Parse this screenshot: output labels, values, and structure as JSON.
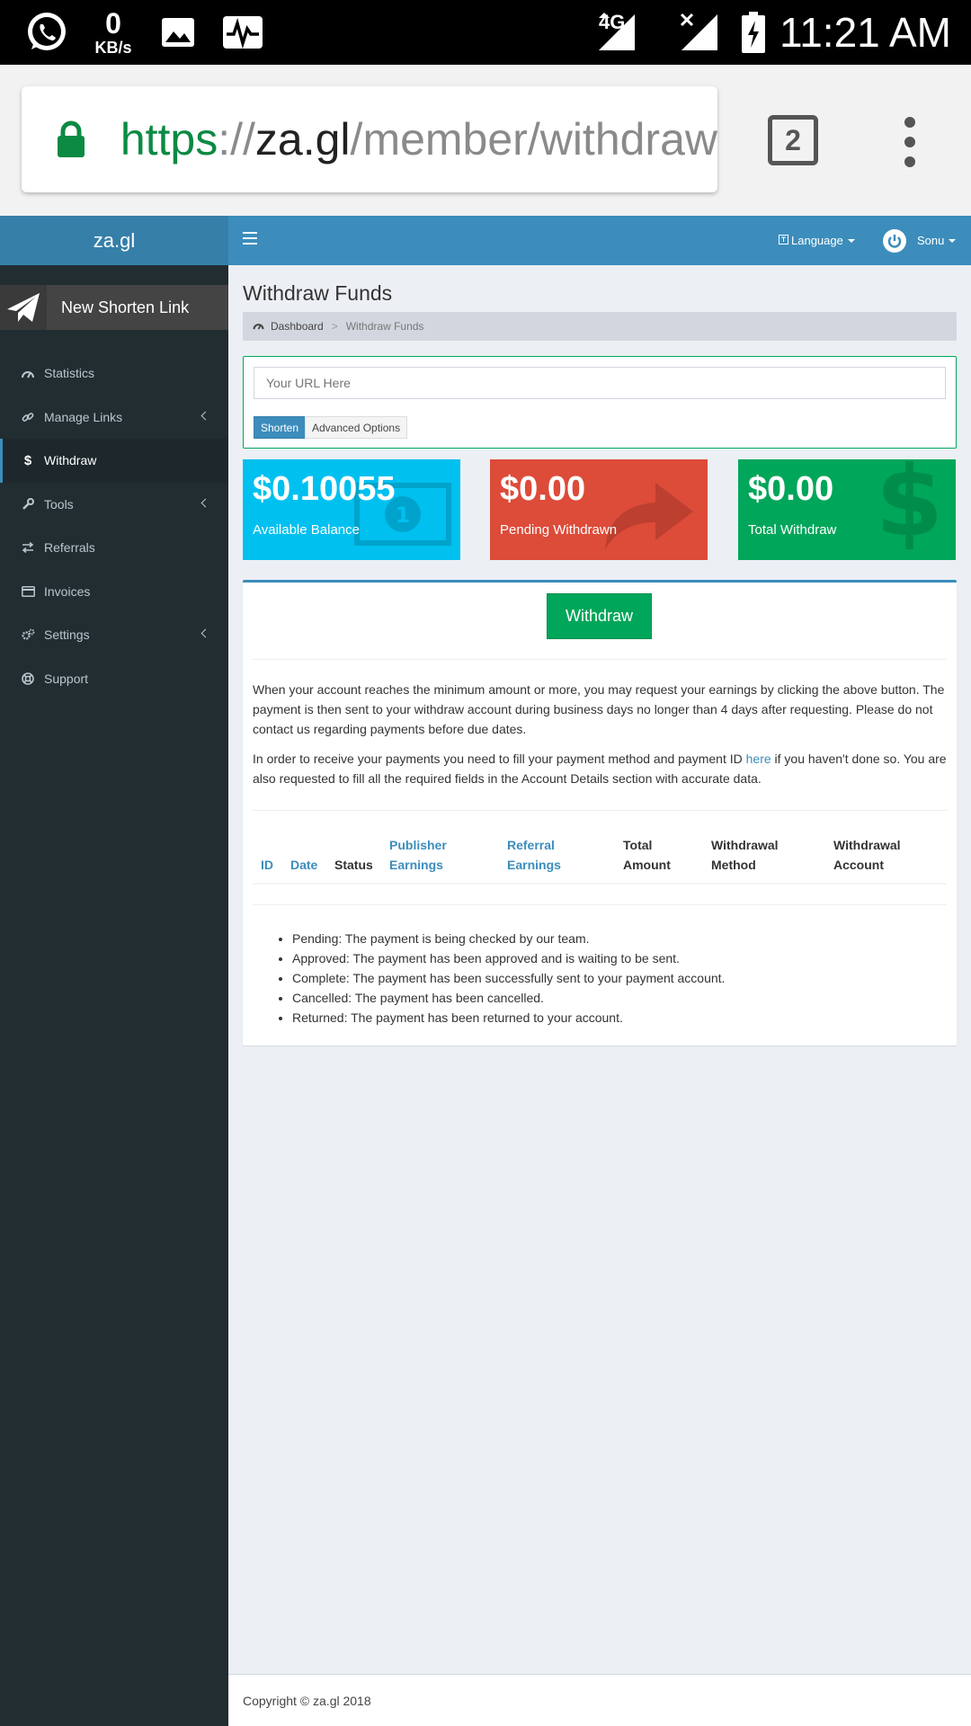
{
  "status_bar": {
    "net_speed_value": "0",
    "net_speed_unit": "KB/s",
    "network_type": "4G",
    "time": "11:21 AM"
  },
  "browser": {
    "url_scheme": "https",
    "url_sep": "://",
    "url_host": "za.gl",
    "url_path": "/member/withdraw",
    "tab_count": "2"
  },
  "header": {
    "brand": "za.gl",
    "language_label": "Language",
    "user_name": "Sonu"
  },
  "sidebar": {
    "new_link_label": "New Shorten Link",
    "items": [
      {
        "label": "Statistics",
        "icon": "dashboard-icon"
      },
      {
        "label": "Manage Links",
        "icon": "link-icon"
      },
      {
        "label": "Withdraw",
        "icon": "dollar-icon"
      },
      {
        "label": "Tools",
        "icon": "wrench-icon"
      },
      {
        "label": "Referrals",
        "icon": "exchange-icon"
      },
      {
        "label": "Invoices",
        "icon": "credit-card-icon"
      },
      {
        "label": "Settings",
        "icon": "gears-icon"
      },
      {
        "label": "Support",
        "icon": "lifebuoy-icon"
      }
    ]
  },
  "page": {
    "title": "Withdraw Funds",
    "breadcrumb": {
      "home": "Dashboard",
      "separator": ">",
      "current": "Withdraw Funds"
    }
  },
  "shorten": {
    "placeholder": "Your URL Here",
    "shorten_label": "Shorten",
    "advanced_label": "Advanced Options"
  },
  "stats": [
    {
      "amount": "$0.10055",
      "label": "Available Balance",
      "color": "#00c0ef"
    },
    {
      "amount": "$0.00",
      "label": "Pending Withdrawn",
      "color": "#dd4b39"
    },
    {
      "amount": "$0.00",
      "label": "Total Withdraw",
      "color": "#00a65a"
    }
  ],
  "withdraw": {
    "button_label": "Withdraw",
    "paragraph1": "When your account reaches the minimum amount or more, you may request your earnings by clicking the above button. The payment is then sent to your withdraw account during business days no longer than 4 days after requesting. Please do not contact us regarding payments before due dates.",
    "paragraph2_before": "In order to receive your payments you need to fill your payment method and payment ID ",
    "paragraph2_link": "here",
    "paragraph2_after": " if you haven't done so. You are also requested to fill all the required fields in the Account Details section with accurate data."
  },
  "table": {
    "headers": [
      {
        "line1": "ID",
        "line2": ""
      },
      {
        "line1": "Date",
        "line2": ""
      },
      {
        "line1": "Status",
        "line2": ""
      },
      {
        "line1": "Publisher",
        "line2": "Earnings"
      },
      {
        "line1": "Referral",
        "line2": "Earnings"
      },
      {
        "line1": "Total",
        "line2": "Amount"
      },
      {
        "line1": "Withdrawal",
        "line2": "Method"
      },
      {
        "line1": "Withdrawal",
        "line2": "Account"
      }
    ]
  },
  "legend": [
    "Pending: The payment is being checked by our team.",
    "Approved: The payment has been approved and is waiting to be sent.",
    "Complete: The payment has been successfully sent to your payment account.",
    "Cancelled: The payment has been cancelled.",
    "Returned: The payment has been returned to your account."
  ],
  "footer": {
    "copyright": "Copyright © za.gl 2018"
  },
  "colors": {
    "navbar": "#3c8dbc",
    "sidebar": "#222d32",
    "content_bg": "#ecf0f5",
    "link": "#3c8dbc"
  }
}
